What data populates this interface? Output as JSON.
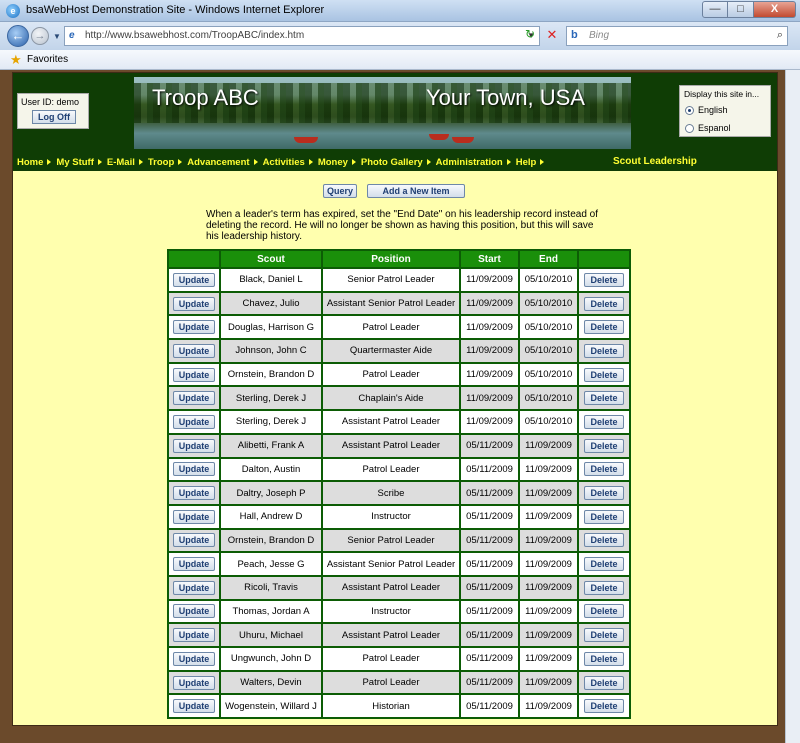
{
  "window": {
    "title": "bsaWebHost Demonstration Site - Windows Internet Explorer",
    "minimize": "—",
    "maximize": "□",
    "close": "X"
  },
  "browser": {
    "address": "http://www.bsawebhost.com/TroopABC/index.htm",
    "search_placeholder": "Bing",
    "favorites_label": "Favorites"
  },
  "header": {
    "user_label": "User ID:  demo",
    "logoff_label": "Log Off",
    "banner_left": "Troop ABC",
    "banner_right": "Your Town, USA",
    "language": {
      "title": "Display this site in...",
      "english": "English",
      "spanish": "Espanol",
      "selected": "English"
    }
  },
  "menu": {
    "items": [
      "Home",
      "My Stuff",
      "E-Mail",
      "Troop",
      "Advancement",
      "Activities",
      "Money",
      "Photo Gallery",
      "Administration",
      "Help"
    ],
    "section_title": "Scout Leadership"
  },
  "actions": {
    "query": "Query",
    "add": "Add a New Item"
  },
  "notice": "When a leader's term has expired, set the \"End Date\" on his leadership record instead of deleting the record. He will no longer be shown as having this position, but this will save his leadership history.",
  "table": {
    "headers": [
      "",
      "Scout",
      "Position",
      "Start",
      "End",
      ""
    ],
    "update_label": "Update",
    "delete_label": "Delete",
    "rows": [
      [
        "Black, Daniel L",
        "Senior Patrol Leader",
        "11/09/2009",
        "05/10/2010"
      ],
      [
        "Chavez, Julio",
        "Assistant Senior Patrol Leader",
        "11/09/2009",
        "05/10/2010"
      ],
      [
        "Douglas, Harrison G",
        "Patrol Leader",
        "11/09/2009",
        "05/10/2010"
      ],
      [
        "Johnson, John C",
        "Quartermaster Aide",
        "11/09/2009",
        "05/10/2010"
      ],
      [
        "Ornstein, Brandon D",
        "Patrol Leader",
        "11/09/2009",
        "05/10/2010"
      ],
      [
        "Sterling, Derek J",
        "Chaplain's Aide",
        "11/09/2009",
        "05/10/2010"
      ],
      [
        "Sterling, Derek J",
        "Assistant Patrol Leader",
        "11/09/2009",
        "05/10/2010"
      ],
      [
        "Alibetti, Frank A",
        "Assistant Patrol Leader",
        "05/11/2009",
        "11/09/2009"
      ],
      [
        "Dalton, Austin",
        "Patrol Leader",
        "05/11/2009",
        "11/09/2009"
      ],
      [
        "Daltry, Joseph P",
        "Scribe",
        "05/11/2009",
        "11/09/2009"
      ],
      [
        "Hall, Andrew D",
        "Instructor",
        "05/11/2009",
        "11/09/2009"
      ],
      [
        "Ornstein, Brandon D",
        "Senior Patrol Leader",
        "05/11/2009",
        "11/09/2009"
      ],
      [
        "Peach, Jesse G",
        "Assistant Senior Patrol Leader",
        "05/11/2009",
        "11/09/2009"
      ],
      [
        "Ricoli, Travis",
        "Assistant Patrol Leader",
        "05/11/2009",
        "11/09/2009"
      ],
      [
        "Thomas, Jordan A",
        "Instructor",
        "05/11/2009",
        "11/09/2009"
      ],
      [
        "Uhuru, Michael",
        "Assistant Patrol Leader",
        "05/11/2009",
        "11/09/2009"
      ],
      [
        "Ungwunch, John D",
        "Patrol Leader",
        "05/11/2009",
        "11/09/2009"
      ],
      [
        "Walters, Devin",
        "Patrol Leader",
        "05/11/2009",
        "11/09/2009"
      ],
      [
        "Wogenstein, Willard J",
        "Historian",
        "05/11/2009",
        "11/09/2009"
      ]
    ]
  },
  "colors": {
    "page_background": "#ffffae",
    "header_green": "#0f3d05",
    "table_header_green": "#1a8f0a",
    "menu_text_yellow": "#ffff33",
    "alt_row_gray": "#dddddd"
  }
}
